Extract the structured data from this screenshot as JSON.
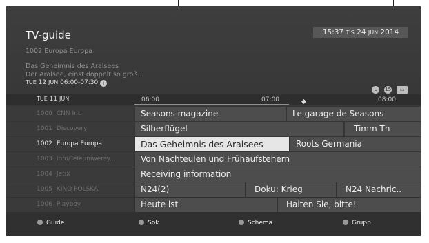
{
  "header": {
    "title": "TV-guide",
    "clock": {
      "time": "15:37",
      "weekday": "TIS",
      "day": "24",
      "month": "JUN",
      "year": "2014"
    },
    "channel": "1002   Europa Europa",
    "program_title": "Das Geheimnis des Aralsees",
    "description": "Der Aralsee, einst doppelt so groß...",
    "program_time": {
      "weekday": "TUE",
      "day": "12",
      "month": "JUN",
      "range": "06:00-07:30"
    },
    "info_icon": "i",
    "badges": [
      {
        "icon": "clock-icon",
        "text": "L"
      },
      {
        "icon": "age-rating-icon",
        "text": "15"
      },
      {
        "icon": "subtitles-icon",
        "text": "▭"
      }
    ]
  },
  "timebar": {
    "date_weekday": "TUE",
    "date_day": "11",
    "date_month": "JUN",
    "ticks": [
      "06:00",
      "07:00",
      "08:00"
    ]
  },
  "channels": [
    {
      "number": "1000",
      "name": "CNN Int.",
      "selected": false,
      "programs": [
        {
          "title": "Seasons magazine"
        },
        {
          "title": "Le garage de Seasons"
        }
      ]
    },
    {
      "number": "1001",
      "name": "Discovery",
      "selected": false,
      "programs": [
        {
          "title": "Silberflügel"
        },
        {
          "title": "Timm Th"
        }
      ]
    },
    {
      "number": "1002",
      "name": "Europa Europa",
      "selected": true,
      "programs": [
        {
          "title": "Das Geheimnis des Aralsees",
          "highlighted": true
        },
        {
          "title": "Roots Germania"
        }
      ]
    },
    {
      "number": "1003",
      "name": "Info/Teleuniwersy...",
      "selected": false,
      "programs": [
        {
          "title": "Von Nachteulen und Frühaufstehern"
        }
      ]
    },
    {
      "number": "1004",
      "name": "Jetix",
      "selected": false,
      "programs": [
        {
          "title": "Receiving information"
        }
      ]
    },
    {
      "number": "1005",
      "name": "KINO POLSKA",
      "selected": false,
      "programs": [
        {
          "title": "N24(2)"
        },
        {
          "title": "Doku: Krieg"
        },
        {
          "title": "N24 Nachric.."
        }
      ]
    },
    {
      "number": "1006",
      "name": "Playboy",
      "selected": false,
      "programs": [
        {
          "title": "Heute ist"
        },
        {
          "title": "Halten Sie, bitte!"
        }
      ]
    }
  ],
  "footer": [
    {
      "label": "Guide",
      "color": "#9a9a9a"
    },
    {
      "label": "Sök",
      "color": "#9a9a9a"
    },
    {
      "label": "Schema",
      "color": "#9a9a9a"
    },
    {
      "label": "Grupp",
      "color": "#9a9a9a"
    }
  ]
}
